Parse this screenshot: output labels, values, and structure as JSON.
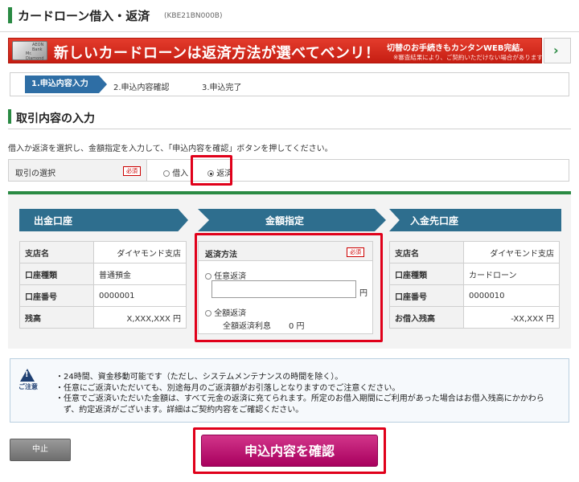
{
  "header": {
    "title": "カードローン借入・返済",
    "code": "(KBE21BN000B)"
  },
  "banner": {
    "card_brand": "AEON Bank",
    "card_name": "Mr. Diamond",
    "headline": "新しいカードローンは返済方法が選べてベンリ！",
    "sub": "切替のお手続きもカンタンWEB完結。",
    "note": "※審査結果により、ご契約いただけない場合があります",
    "next_icon": "chevron-right-icon"
  },
  "steps": [
    {
      "label": "1.申込内容入力"
    },
    {
      "label": "2.申込内容確認"
    },
    {
      "label": "3.申込完了"
    }
  ],
  "section": {
    "title": "取引内容の入力",
    "instruction": "借入か返済を選択し、金額指定を入力して、「申込内容を確認」ボタンを押してください。"
  },
  "transaction_select": {
    "label": "取引の選択",
    "required": "必須",
    "options": [
      {
        "label": "借入",
        "selected": false
      },
      {
        "label": "返済",
        "selected": true
      }
    ]
  },
  "headers": {
    "source": "出金口座",
    "amount": "金額指定",
    "destination": "入金先口座"
  },
  "source_account": {
    "rows": [
      {
        "key": "支店名",
        "value": "ダイヤモンド支店"
      },
      {
        "key": "口座種類",
        "value": "普通預金"
      },
      {
        "key": "口座番号",
        "value": "0000001"
      },
      {
        "key": "残高",
        "value": "X,XXX,XXX 円"
      }
    ]
  },
  "amount": {
    "label": "返済方法",
    "required": "必須",
    "option_any": "任意返済",
    "input_value": "",
    "yen": "円",
    "option_full": "全額返済",
    "interest_label": "全額返済利息",
    "interest_value": "0 円"
  },
  "destination_account": {
    "rows": [
      {
        "key": "支店名",
        "value": "ダイヤモンド支店"
      },
      {
        "key": "口座種類",
        "value": "カードローン"
      },
      {
        "key": "口座番号",
        "value": "0000010"
      },
      {
        "key": "お借入残高",
        "value": "-XX,XXX 円"
      }
    ]
  },
  "notice": {
    "label": "ご注意",
    "lines": [
      "・24時間、資金移動可能です（ただし、システムメンテナンスの時間を除く）。",
      "・任意にご返済いただいても、別途毎月のご返済額がお引落しとなりますのでご注意ください。",
      "・任意でご返済いただいた金額は、すべて元金の返済に充てられます。所定のお借入期間にご利用があった場合はお借入残高にかかわら",
      "　ず、約定返済がございます。詳細はご契約内容をご確認ください。"
    ]
  },
  "buttons": {
    "cancel": "中止",
    "confirm": "申込内容を確認"
  },
  "colors": {
    "accent_green": "#2a8a43",
    "header_blue": "#2e6e8e",
    "highlight_red": "#e0001a",
    "confirm_pink": "#c2187a"
  }
}
